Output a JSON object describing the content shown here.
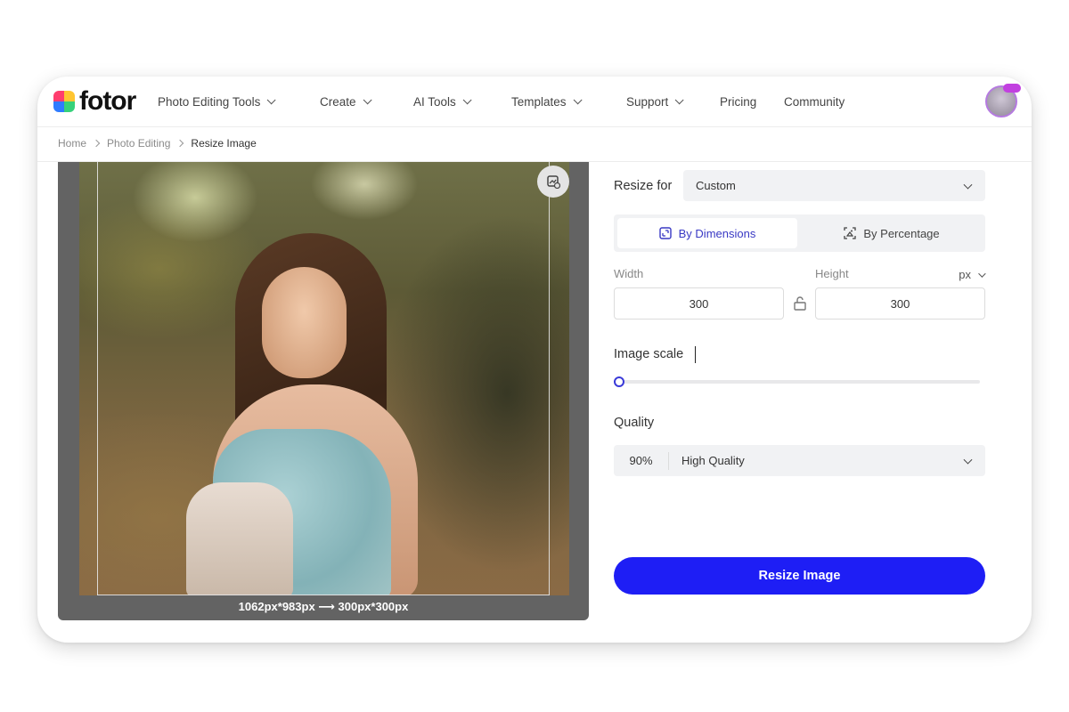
{
  "header": {
    "logo_text": "fotor",
    "nav": [
      {
        "label": "Photo Editing Tools",
        "dropdown": true
      },
      {
        "label": "Create",
        "dropdown": true
      },
      {
        "label": "AI Tools",
        "dropdown": true
      },
      {
        "label": "Templates",
        "dropdown": true
      },
      {
        "label": "Support",
        "dropdown": true
      },
      {
        "label": "Pricing",
        "dropdown": false
      },
      {
        "label": "Community",
        "dropdown": false
      }
    ]
  },
  "breadcrumb": [
    "Home",
    "Photo Editing",
    "Resize Image"
  ],
  "preview": {
    "size_caption": "1062px*983px ⟶ 300px*300px"
  },
  "panel": {
    "resize_for_label": "Resize for",
    "resize_for_value": "Custom",
    "mode_tabs": [
      "By Dimensions",
      "By Percentage"
    ],
    "width_label": "Width",
    "height_label": "Height",
    "unit": "px",
    "width_value": "300",
    "height_value": "300",
    "image_scale_label": "Image scale",
    "image_scale_fraction": 0,
    "quality_label": "Quality",
    "quality_percent": "90%",
    "quality_name": "High Quality",
    "resize_button": "Resize Image"
  },
  "colors": {
    "accent": "#1e1ef5",
    "active_tab_text": "#3838c4"
  }
}
